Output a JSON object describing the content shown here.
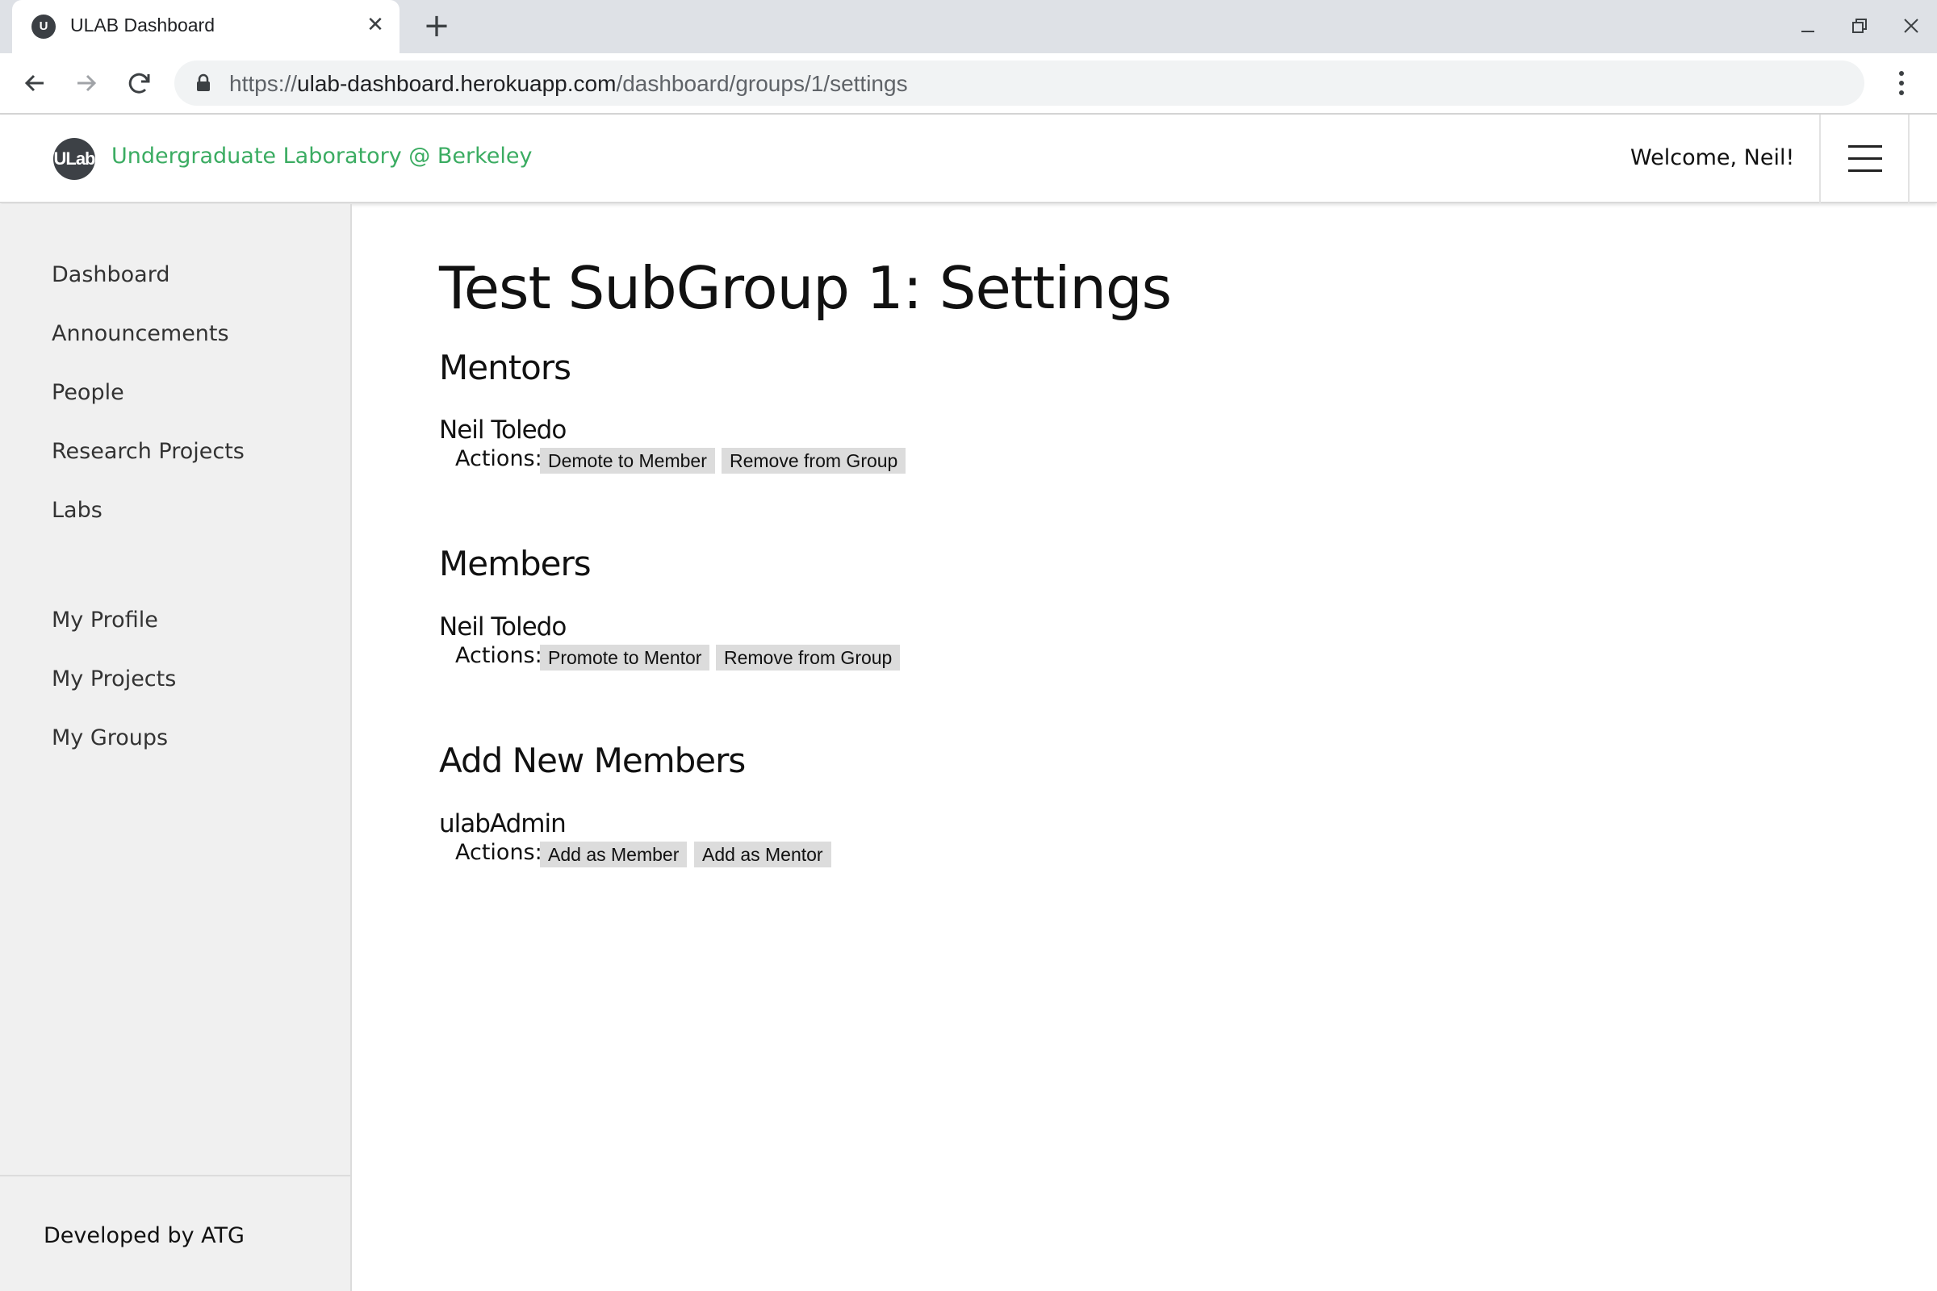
{
  "browser": {
    "tab_title": "ULAB Dashboard",
    "favicon_text": "U",
    "url_scheme": "https://",
    "url_host": "ulab-dashboard.herokuapp.com",
    "url_path": "/dashboard/groups/1/settings"
  },
  "header": {
    "logo_text": "ULab",
    "brand": "Undergraduate Laboratory @ Berkeley",
    "welcome": "Welcome, Neil!",
    "brand_color": "#3bac62"
  },
  "sidebar": {
    "items": [
      {
        "label": "Dashboard"
      },
      {
        "label": "Announcements"
      },
      {
        "label": "People"
      },
      {
        "label": "Research Projects"
      },
      {
        "label": "Labs"
      }
    ],
    "personal_items": [
      {
        "label": "My Profile"
      },
      {
        "label": "My Projects"
      },
      {
        "label": "My Groups"
      }
    ],
    "footer": "Developed by ATG"
  },
  "main": {
    "title": "Test SubGroup 1: Settings",
    "actions_label": "Actions:",
    "mentors": {
      "heading": "Mentors",
      "people": [
        {
          "name": "Neil Toledo",
          "actions": [
            "Demote to Member",
            "Remove from Group"
          ]
        }
      ]
    },
    "members": {
      "heading": "Members",
      "people": [
        {
          "name": "Neil Toledo",
          "actions": [
            "Promote to Mentor",
            "Remove from Group"
          ]
        }
      ]
    },
    "add_new": {
      "heading": "Add New Members",
      "people": [
        {
          "name": "ulabAdmin",
          "actions": [
            "Add as Member",
            "Add as Mentor"
          ]
        }
      ]
    }
  }
}
